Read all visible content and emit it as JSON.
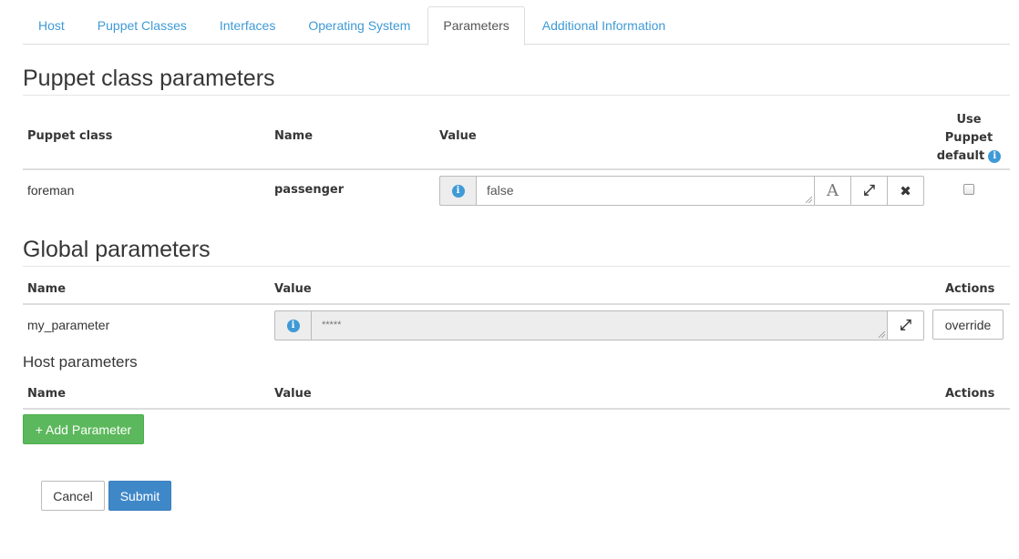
{
  "tabs": [
    {
      "label": "Host",
      "active": false
    },
    {
      "label": "Puppet Classes",
      "active": false
    },
    {
      "label": "Interfaces",
      "active": false
    },
    {
      "label": "Operating System",
      "active": false
    },
    {
      "label": "Parameters",
      "active": true
    },
    {
      "label": "Additional Information",
      "active": false
    }
  ],
  "puppet_section": {
    "title": "Puppet class parameters",
    "headers": {
      "puppet_class": "Puppet class",
      "name": "Name",
      "value": "Value",
      "use_default_line1": "Use",
      "use_default_line2": "Puppet",
      "use_default_line3": "default"
    },
    "rows": [
      {
        "puppet_class": "foreman",
        "name": "passenger",
        "value": "false",
        "use_default_checked": false
      }
    ]
  },
  "global_section": {
    "title": "Global parameters",
    "headers": {
      "name": "Name",
      "value": "Value",
      "actions": "Actions"
    },
    "rows": [
      {
        "name": "my_parameter",
        "value": "*****",
        "action_label": "override"
      }
    ]
  },
  "host_section": {
    "title": "Host parameters",
    "headers": {
      "name": "Name",
      "value": "Value",
      "actions": "Actions"
    },
    "add_button_label": "+ Add Parameter"
  },
  "form_actions": {
    "cancel_label": "Cancel",
    "submit_label": "Submit"
  },
  "icons": {
    "info": "i",
    "input_type": "A",
    "expand": "⤢",
    "remove": "✖"
  },
  "colors": {
    "link": "#3f9ad6",
    "success": "#5cb85c",
    "primary": "#3f88c8"
  }
}
